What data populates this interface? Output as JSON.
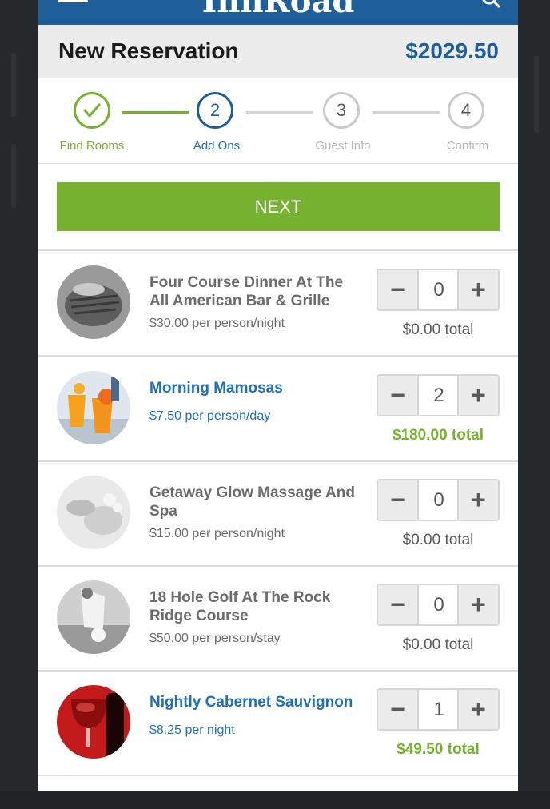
{
  "app": {
    "brand": "InnRoad"
  },
  "header": {
    "title": "New Reservation",
    "total": "$2029.50"
  },
  "steps": [
    {
      "number": "",
      "label": "Find Rooms",
      "state": "done"
    },
    {
      "number": "2",
      "label": "Add Ons",
      "state": "current"
    },
    {
      "number": "3",
      "label": "Guest Info",
      "state": "upcoming"
    },
    {
      "number": "4",
      "label": "Confirm",
      "state": "upcoming"
    }
  ],
  "next_label": "NEXT",
  "addons": [
    {
      "name": "Four Course Dinner At The All American Bar & Grille",
      "price": "$30.00 per person/night",
      "qty": "0",
      "total": "$0.00 total",
      "active": false,
      "image": "steak-photo"
    },
    {
      "name": "Morning Mamosas",
      "price": "$7.50 per person/day",
      "qty": "2",
      "total": "$180.00 total",
      "active": true,
      "image": "mimosas-photo"
    },
    {
      "name": "Getaway Glow Massage And Spa",
      "price": "$15.00 per person/night",
      "qty": "0",
      "total": "$0.00 total",
      "active": false,
      "image": "spa-photo"
    },
    {
      "name": "18 Hole Golf At The Rock Ridge Course",
      "price": "$50.00 per person/stay",
      "qty": "0",
      "total": "$0.00 total",
      "active": false,
      "image": "golf-photo"
    },
    {
      "name": "Nightly Cabernet Sauvignon",
      "price": "$8.25 per night",
      "qty": "1",
      "total": "$49.50 total",
      "active": true,
      "image": "wine-photo"
    }
  ],
  "stepper": {
    "minus": "−",
    "plus": "+"
  },
  "colors": {
    "brand_blue": "#1e5f9a",
    "accent_green": "#76b22f",
    "link_blue": "#1e70b8"
  }
}
